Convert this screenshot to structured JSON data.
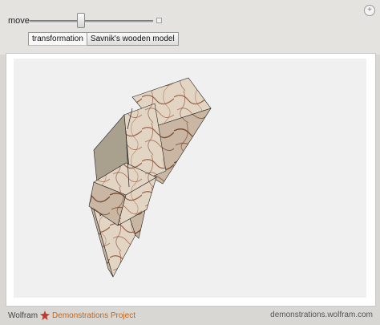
{
  "controls": {
    "move_label": "move",
    "move_value": 0.41,
    "corner_icon": "plus-icon"
  },
  "tabs": [
    {
      "label": "transformation",
      "active": true
    },
    {
      "label": "Savnik's wooden model",
      "active": false
    }
  ],
  "footer": {
    "brand_prefix": "Wolfram",
    "brand_icon": "spikey-icon",
    "brand_name": "Demonstrations Project",
    "url": "demonstrations.wolfram.com"
  },
  "colors": {
    "brand_orange": "#c4661a",
    "marble_light": "#e3d5c4",
    "marble_vein": "#8a4a30"
  }
}
